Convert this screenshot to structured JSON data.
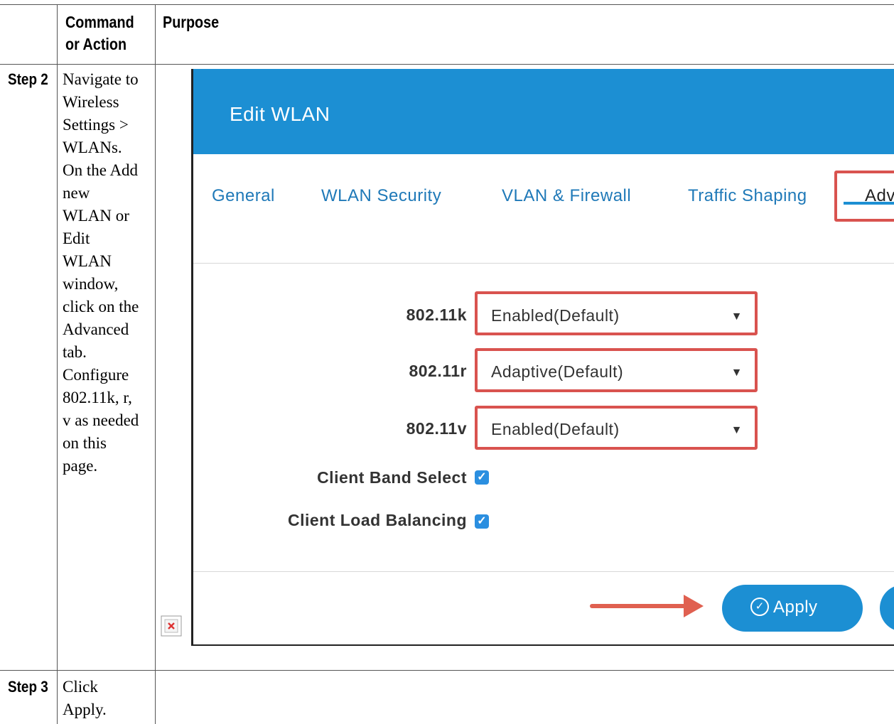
{
  "table": {
    "headers": {
      "step": "",
      "command": "Command or Action",
      "purpose": "Purpose"
    },
    "rows": [
      {
        "step": "Step 2",
        "command_lines": [
          "Navigate to",
          "Wireless",
          "Settings >",
          "WLANs.",
          "On the Add",
          "new",
          "WLAN or",
          "Edit",
          "WLAN",
          "window,",
          "click on the",
          "Advanced",
          "tab.",
          "Configure",
          "802.11k, r,",
          "v as needed",
          "on this",
          "page."
        ]
      },
      {
        "step": "Step 3",
        "command_lines": [
          "Click",
          "Apply."
        ]
      }
    ]
  },
  "screenshot": {
    "window_title": "Edit WLAN",
    "tabs": [
      {
        "label": "General"
      },
      {
        "label": "WLAN Security"
      },
      {
        "label": "VLAN & Firewall"
      },
      {
        "label": "Traffic Shaping"
      },
      {
        "label": "Adv"
      }
    ],
    "fields": [
      {
        "label": "802.11k",
        "value": "Enabled(Default)"
      },
      {
        "label": "802.11r",
        "value": "Adaptive(Default)"
      },
      {
        "label": "802.11v",
        "value": "Enabled(Default)"
      }
    ],
    "checkboxes": [
      {
        "label": "Client Band Select",
        "checked": true
      },
      {
        "label": "Client Load Balancing",
        "checked": true
      }
    ],
    "apply_label": "Apply",
    "colors": {
      "header_blue": "#1c8fd3",
      "highlight_red": "#d9534f",
      "arrow_red": "#e06050"
    }
  }
}
